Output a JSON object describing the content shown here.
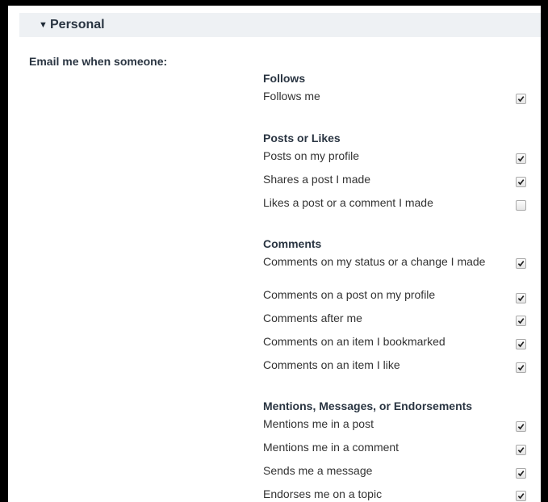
{
  "section": {
    "title": "Personal",
    "arrow_icon": "triangle-down-icon"
  },
  "email_label": "Email me when someone:",
  "groups": [
    {
      "title": "Follows",
      "options": [
        {
          "label": "Follows me",
          "checked": true
        }
      ]
    },
    {
      "title": "Posts or Likes",
      "options": [
        {
          "label": "Posts on my profile",
          "checked": true
        },
        {
          "label": "Shares a post I made",
          "checked": true
        },
        {
          "label": "Likes a post or a comment I made",
          "checked": false
        }
      ]
    },
    {
      "title": "Comments",
      "options": [
        {
          "label": "Comments on my status or a change I made",
          "checked": true
        },
        {
          "label": "Comments on a post on my profile",
          "checked": true
        },
        {
          "label": "Comments after me",
          "checked": true
        },
        {
          "label": "Comments on an item I bookmarked",
          "checked": true
        },
        {
          "label": "Comments on an item I like",
          "checked": true
        }
      ]
    },
    {
      "title": "Mentions, Messages, or Endorsements",
      "options": [
        {
          "label": "Mentions me in a post",
          "checked": true
        },
        {
          "label": "Mentions me in a comment",
          "checked": true
        },
        {
          "label": "Sends me a message",
          "checked": true
        },
        {
          "label": "Endorses me on a topic",
          "checked": true
        }
      ]
    }
  ]
}
